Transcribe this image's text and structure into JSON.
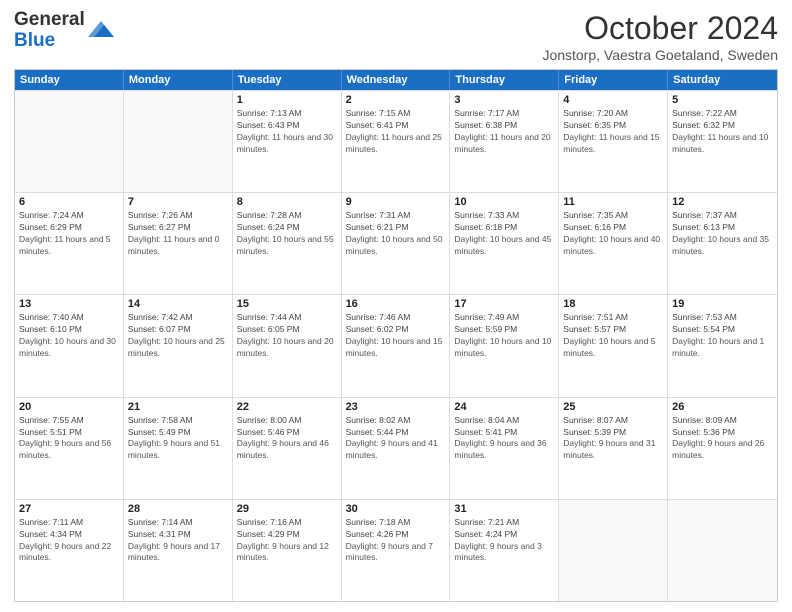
{
  "header": {
    "logo_general": "General",
    "logo_blue": "Blue",
    "month": "October 2024",
    "location": "Jonstorp, Vaestra Goetaland, Sweden"
  },
  "weekdays": [
    "Sunday",
    "Monday",
    "Tuesday",
    "Wednesday",
    "Thursday",
    "Friday",
    "Saturday"
  ],
  "weeks": [
    [
      {
        "day": "",
        "sunrise": "",
        "sunset": "",
        "daylight": ""
      },
      {
        "day": "",
        "sunrise": "",
        "sunset": "",
        "daylight": ""
      },
      {
        "day": "1",
        "sunrise": "Sunrise: 7:13 AM",
        "sunset": "Sunset: 6:43 PM",
        "daylight": "Daylight: 11 hours and 30 minutes."
      },
      {
        "day": "2",
        "sunrise": "Sunrise: 7:15 AM",
        "sunset": "Sunset: 6:41 PM",
        "daylight": "Daylight: 11 hours and 25 minutes."
      },
      {
        "day": "3",
        "sunrise": "Sunrise: 7:17 AM",
        "sunset": "Sunset: 6:38 PM",
        "daylight": "Daylight: 11 hours and 20 minutes."
      },
      {
        "day": "4",
        "sunrise": "Sunrise: 7:20 AM",
        "sunset": "Sunset: 6:35 PM",
        "daylight": "Daylight: 11 hours and 15 minutes."
      },
      {
        "day": "5",
        "sunrise": "Sunrise: 7:22 AM",
        "sunset": "Sunset: 6:32 PM",
        "daylight": "Daylight: 11 hours and 10 minutes."
      }
    ],
    [
      {
        "day": "6",
        "sunrise": "Sunrise: 7:24 AM",
        "sunset": "Sunset: 6:29 PM",
        "daylight": "Daylight: 11 hours and 5 minutes."
      },
      {
        "day": "7",
        "sunrise": "Sunrise: 7:26 AM",
        "sunset": "Sunset: 6:27 PM",
        "daylight": "Daylight: 11 hours and 0 minutes."
      },
      {
        "day": "8",
        "sunrise": "Sunrise: 7:28 AM",
        "sunset": "Sunset: 6:24 PM",
        "daylight": "Daylight: 10 hours and 55 minutes."
      },
      {
        "day": "9",
        "sunrise": "Sunrise: 7:31 AM",
        "sunset": "Sunset: 6:21 PM",
        "daylight": "Daylight: 10 hours and 50 minutes."
      },
      {
        "day": "10",
        "sunrise": "Sunrise: 7:33 AM",
        "sunset": "Sunset: 6:18 PM",
        "daylight": "Daylight: 10 hours and 45 minutes."
      },
      {
        "day": "11",
        "sunrise": "Sunrise: 7:35 AM",
        "sunset": "Sunset: 6:16 PM",
        "daylight": "Daylight: 10 hours and 40 minutes."
      },
      {
        "day": "12",
        "sunrise": "Sunrise: 7:37 AM",
        "sunset": "Sunset: 6:13 PM",
        "daylight": "Daylight: 10 hours and 35 minutes."
      }
    ],
    [
      {
        "day": "13",
        "sunrise": "Sunrise: 7:40 AM",
        "sunset": "Sunset: 6:10 PM",
        "daylight": "Daylight: 10 hours and 30 minutes."
      },
      {
        "day": "14",
        "sunrise": "Sunrise: 7:42 AM",
        "sunset": "Sunset: 6:07 PM",
        "daylight": "Daylight: 10 hours and 25 minutes."
      },
      {
        "day": "15",
        "sunrise": "Sunrise: 7:44 AM",
        "sunset": "Sunset: 6:05 PM",
        "daylight": "Daylight: 10 hours and 20 minutes."
      },
      {
        "day": "16",
        "sunrise": "Sunrise: 7:46 AM",
        "sunset": "Sunset: 6:02 PM",
        "daylight": "Daylight: 10 hours and 15 minutes."
      },
      {
        "day": "17",
        "sunrise": "Sunrise: 7:49 AM",
        "sunset": "Sunset: 5:59 PM",
        "daylight": "Daylight: 10 hours and 10 minutes."
      },
      {
        "day": "18",
        "sunrise": "Sunrise: 7:51 AM",
        "sunset": "Sunset: 5:57 PM",
        "daylight": "Daylight: 10 hours and 5 minutes."
      },
      {
        "day": "19",
        "sunrise": "Sunrise: 7:53 AM",
        "sunset": "Sunset: 5:54 PM",
        "daylight": "Daylight: 10 hours and 1 minute."
      }
    ],
    [
      {
        "day": "20",
        "sunrise": "Sunrise: 7:55 AM",
        "sunset": "Sunset: 5:51 PM",
        "daylight": "Daylight: 9 hours and 56 minutes."
      },
      {
        "day": "21",
        "sunrise": "Sunrise: 7:58 AM",
        "sunset": "Sunset: 5:49 PM",
        "daylight": "Daylight: 9 hours and 51 minutes."
      },
      {
        "day": "22",
        "sunrise": "Sunrise: 8:00 AM",
        "sunset": "Sunset: 5:46 PM",
        "daylight": "Daylight: 9 hours and 46 minutes."
      },
      {
        "day": "23",
        "sunrise": "Sunrise: 8:02 AM",
        "sunset": "Sunset: 5:44 PM",
        "daylight": "Daylight: 9 hours and 41 minutes."
      },
      {
        "day": "24",
        "sunrise": "Sunrise: 8:04 AM",
        "sunset": "Sunset: 5:41 PM",
        "daylight": "Daylight: 9 hours and 36 minutes."
      },
      {
        "day": "25",
        "sunrise": "Sunrise: 8:07 AM",
        "sunset": "Sunset: 5:39 PM",
        "daylight": "Daylight: 9 hours and 31 minutes."
      },
      {
        "day": "26",
        "sunrise": "Sunrise: 8:09 AM",
        "sunset": "Sunset: 5:36 PM",
        "daylight": "Daylight: 9 hours and 26 minutes."
      }
    ],
    [
      {
        "day": "27",
        "sunrise": "Sunrise: 7:11 AM",
        "sunset": "Sunset: 4:34 PM",
        "daylight": "Daylight: 9 hours and 22 minutes."
      },
      {
        "day": "28",
        "sunrise": "Sunrise: 7:14 AM",
        "sunset": "Sunset: 4:31 PM",
        "daylight": "Daylight: 9 hours and 17 minutes."
      },
      {
        "day": "29",
        "sunrise": "Sunrise: 7:16 AM",
        "sunset": "Sunset: 4:29 PM",
        "daylight": "Daylight: 9 hours and 12 minutes."
      },
      {
        "day": "30",
        "sunrise": "Sunrise: 7:18 AM",
        "sunset": "Sunset: 4:26 PM",
        "daylight": "Daylight: 9 hours and 7 minutes."
      },
      {
        "day": "31",
        "sunrise": "Sunrise: 7:21 AM",
        "sunset": "Sunset: 4:24 PM",
        "daylight": "Daylight: 9 hours and 3 minutes."
      },
      {
        "day": "",
        "sunrise": "",
        "sunset": "",
        "daylight": ""
      },
      {
        "day": "",
        "sunrise": "",
        "sunset": "",
        "daylight": ""
      }
    ]
  ]
}
